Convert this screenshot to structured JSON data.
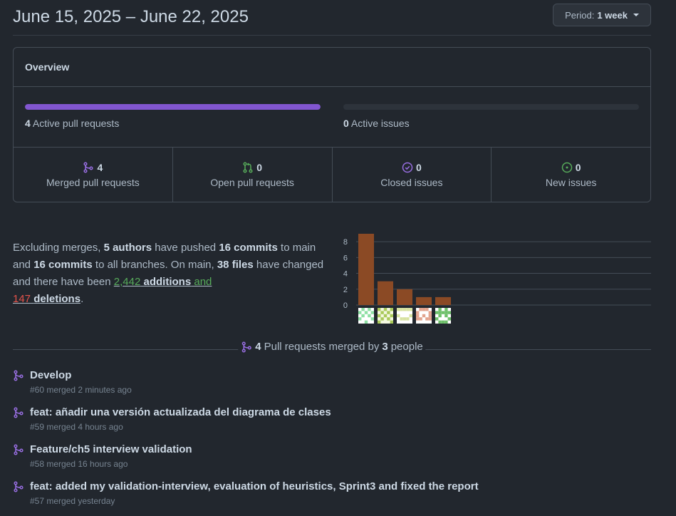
{
  "header": {
    "date_range": "June 15, 2025 – June 22, 2025",
    "period_label": "Period:",
    "period_value": "1 week"
  },
  "overview": {
    "title": "Overview",
    "pull_requests": {
      "count": "4",
      "label": "Active pull requests",
      "fill_fraction": 1.0
    },
    "issues": {
      "count": "0",
      "label": "Active issues",
      "fill_fraction": 0.0
    },
    "stats": [
      {
        "icon": "merged-pr-icon",
        "value": "4",
        "label": "Merged pull requests",
        "color": "#986ee2"
      },
      {
        "icon": "open-pr-icon",
        "value": "0",
        "label": "Open pull requests",
        "color": "#57ab5a"
      },
      {
        "icon": "closed-issue-icon",
        "value": "0",
        "label": "Closed issues",
        "color": "#986ee2"
      },
      {
        "icon": "new-issue-icon",
        "value": "0",
        "label": "New issues",
        "color": "#57ab5a"
      }
    ]
  },
  "summary": {
    "t1": "Excluding merges, ",
    "authors": "5 authors",
    "t2": " have pushed ",
    "commits_main": "16 commits",
    "t3": " to main and ",
    "commits_all": "16 commits",
    "t4": " to all branches. On main, ",
    "files": "38 files",
    "t5": " have changed and there have been ",
    "additions_count": "2,442",
    "additions_word": "additions",
    "t6": " and",
    "deletions_count": "147",
    "deletions_word": "deletions",
    "t7": "."
  },
  "chart_data": {
    "type": "bar",
    "categories": [
      "author-1",
      "author-2",
      "author-3",
      "author-4",
      "author-5"
    ],
    "values": [
      9,
      3,
      2,
      1,
      1
    ],
    "ylim": [
      0,
      9
    ],
    "yticks": [
      "0",
      "2",
      "4",
      "6",
      "8"
    ],
    "bar_color": "#8b4a25",
    "grid": true
  },
  "pr_section": {
    "count": "4",
    "t1": "Pull requests merged by",
    "people": "3",
    "t2": "people"
  },
  "pull_requests": [
    {
      "title": "Develop",
      "meta": "#60 merged 2 minutes ago"
    },
    {
      "title": "feat: añadir una versión actualizada del diagrama de clases",
      "meta": "#59 merged 4 hours ago"
    },
    {
      "title": "Feature/ch5 interview validation",
      "meta": "#58 merged 16 hours ago"
    },
    {
      "title": "feat: added my validation-interview, evaluation of heuristics, Sprint3 and fixed the report",
      "meta": "#57 merged yesterday"
    }
  ],
  "colors": {
    "accent_purple": "#8256d0",
    "green": "#57ab5a",
    "red": "#e5534b",
    "background": "#22272e"
  }
}
